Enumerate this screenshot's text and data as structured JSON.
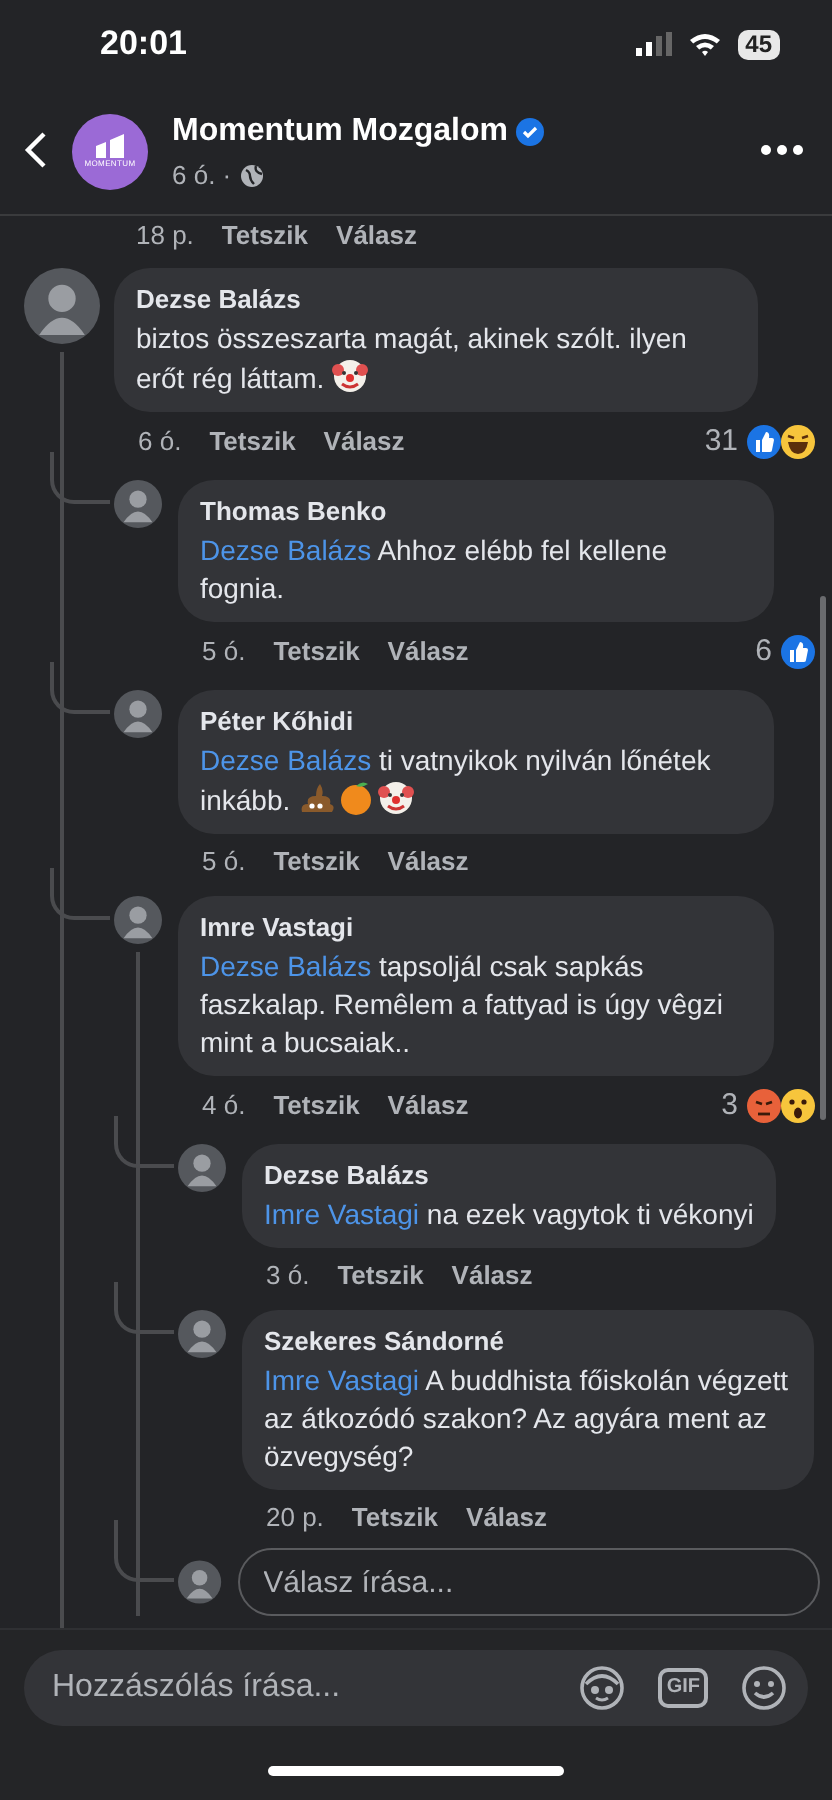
{
  "status_bar": {
    "time": "20:01",
    "battery": "45"
  },
  "header": {
    "logo_text": "MOMENTUM",
    "page_name": "Momentum Mozgalom",
    "verified": true,
    "time": "6 ó. ·"
  },
  "partial_row": {
    "time": "18 p.",
    "like": "Tetszik",
    "reply": "Válasz"
  },
  "comments": [
    {
      "author": "Dezse Balázs",
      "text": "biztos összeszarta magát, akinek szólt. ilyen erőt rég láttam. ",
      "emojis": [
        {
          "kind": "clown"
        }
      ],
      "time": "6 ó.",
      "like": "Tetszik",
      "reply": "Válasz",
      "reaction_count": "31",
      "reactions": [
        {
          "kind": "like"
        },
        {
          "kind": "haha"
        }
      ],
      "replies": [
        {
          "author": "Thomas Benko",
          "mention": "Dezse Balázs",
          "text": " Ahhoz elébb fel kellene fognia.",
          "time": "5 ó.",
          "like": "Tetszik",
          "reply": "Válasz",
          "reaction_count": "6",
          "reactions": [
            {
              "kind": "like"
            }
          ]
        },
        {
          "author": "Péter Kőhidi",
          "mention": "Dezse Balázs",
          "text": " ti vatnyikok nyilván lőnétek inkább. ",
          "emojis": [
            {
              "kind": "poop"
            },
            {
              "kind": "tangerine"
            },
            {
              "kind": "clown"
            }
          ],
          "time": "5 ó.",
          "like": "Tetszik",
          "reply": "Válasz"
        },
        {
          "author": "Imre Vastagi",
          "mention": "Dezse Balázs",
          "text": " tapsoljál csak sapkás faszkalap. Remêlem a fattyad is úgy vêgzi mint a bucsaiak..",
          "time": "4 ó.",
          "like": "Tetszik",
          "reply": "Válasz",
          "reaction_count": "3",
          "reactions": [
            {
              "kind": "angry"
            },
            {
              "kind": "wow"
            }
          ],
          "replies": [
            {
              "author": "Dezse Balázs",
              "mention": "Imre Vastagi",
              "text": " na ezek vagytok ti vékonyi",
              "time": "3 ó.",
              "like": "Tetszik",
              "reply": "Válasz"
            },
            {
              "author": "Szekeres Sándorné",
              "mention": "Imre Vastagi",
              "text": " A buddhista főiskolán végzett az átkozódó szakon? Az agyára ment az özvegység?",
              "time": "20 p.",
              "like": "Tetszik",
              "reply": "Válasz"
            }
          ],
          "reply_box": {
            "placeholder": "Válasz írása..."
          }
        }
      ]
    }
  ],
  "composer": {
    "placeholder": "Hozzászólás írása...",
    "gif_label": "GIF"
  }
}
